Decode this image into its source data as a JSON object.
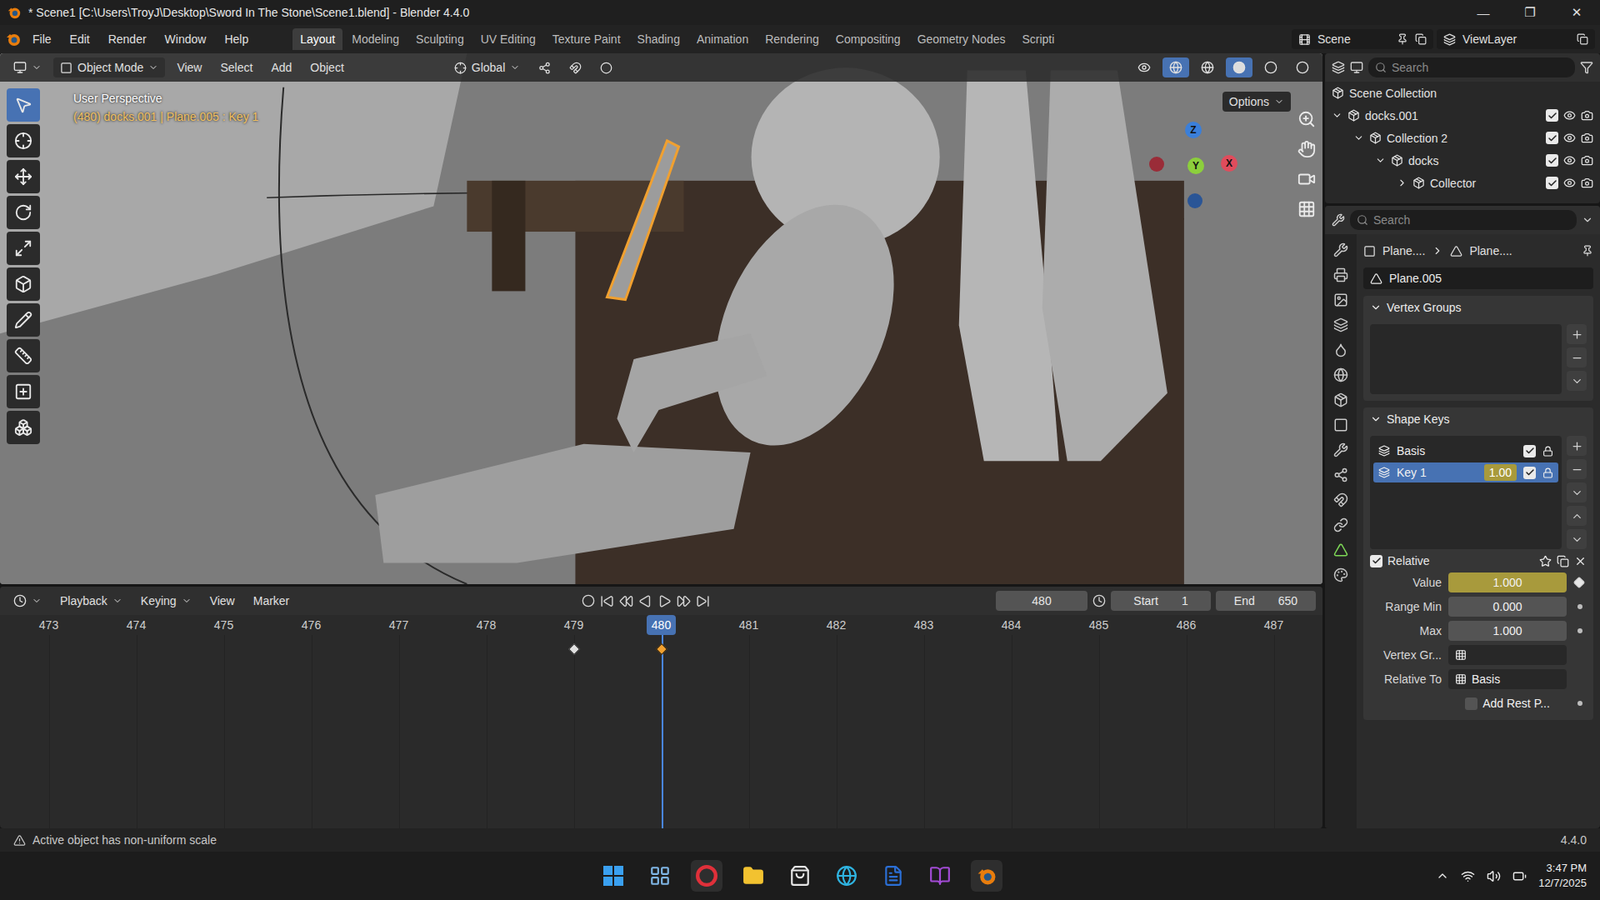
{
  "window": {
    "title": "* Scene1 [C:\\Users\\TroyJ\\Desktop\\Sword In The Stone\\Scene1.blend] - Blender 4.4.0",
    "controls": [
      "—",
      "❐",
      "✕"
    ]
  },
  "menu": [
    "File",
    "Edit",
    "Render",
    "Window",
    "Help"
  ],
  "workspaces": [
    {
      "label": "Layout",
      "selected": true
    },
    {
      "label": "Modeling",
      "selected": false
    },
    {
      "label": "Sculpting",
      "selected": false
    },
    {
      "label": "UV Editing",
      "selected": false
    },
    {
      "label": "Texture Paint",
      "selected": false
    },
    {
      "label": "Shading",
      "selected": false
    },
    {
      "label": "Animation",
      "selected": false
    },
    {
      "label": "Rendering",
      "selected": false
    },
    {
      "label": "Compositing",
      "selected": false
    },
    {
      "label": "Geometry Nodes",
      "selected": false
    },
    {
      "label": "Scripti",
      "selected": false
    }
  ],
  "scene": "Scene",
  "view_layer": "ViewLayer",
  "viewport": {
    "mode": "Object Mode",
    "menus": [
      "View",
      "Select",
      "Add",
      "Object"
    ],
    "orientation": "Global",
    "options": "Options",
    "view_name": "User Perspective",
    "info": "(480) docks.001 | Plane.005 : Key 1",
    "axes": [
      "X",
      "Y",
      "Z"
    ],
    "tools": [
      {
        "selected": true
      },
      {
        "selected": false
      },
      {
        "selected": false
      },
      {
        "selected": false
      },
      {
        "selected": false
      },
      {
        "selected": false
      },
      {
        "selected": false
      },
      {
        "selected": false
      },
      {
        "selected": false
      },
      {
        "selected": false
      }
    ]
  },
  "outliner": {
    "search": "Search",
    "root": "Scene Collection",
    "items": [
      {
        "name": "docks.001",
        "depth": 0,
        "expanded": true,
        "checked": true
      },
      {
        "name": "Collection 2",
        "depth": 1,
        "expanded": true,
        "checked": true
      },
      {
        "name": "docks",
        "depth": 2,
        "expanded": true,
        "checked": true
      },
      {
        "name": "Collector",
        "depth": 3,
        "expanded": false,
        "checked": true
      }
    ]
  },
  "properties": {
    "search": "Search",
    "breadcrumb": [
      "Plane....",
      "Plane...."
    ],
    "mesh": "Plane.005",
    "vertex_groups": {
      "title": "Vertex Groups",
      "expanded": true
    },
    "shape_keys": {
      "title": "Shape Keys",
      "expanded": true,
      "items": [
        {
          "name": "Basis",
          "value": "",
          "checked": true,
          "selected": false
        },
        {
          "name": "Key 1",
          "value": "1.00",
          "checked": true,
          "selected": true
        }
      ],
      "relative": {
        "label": "Relative",
        "checked": true
      },
      "fields": [
        {
          "label": "Value",
          "value": "1.000",
          "kind": "keyed"
        },
        {
          "label": "Range Min",
          "value": "0.000",
          "kind": "number"
        },
        {
          "label": "Max",
          "value": "1.000",
          "kind": "number"
        },
        {
          "label": "Vertex Gr...",
          "value": "",
          "kind": "picker"
        },
        {
          "label": "Relative To",
          "value": "Basis",
          "kind": "picker"
        },
        {
          "label": "Add Rest P...",
          "value": "",
          "kind": "checkbox",
          "checked": false
        }
      ]
    }
  },
  "timeline": {
    "menus": [
      "Playback",
      "Keying",
      "View",
      "Marker"
    ],
    "frame": "480",
    "start_label": "Start",
    "start": "1",
    "end_label": "End",
    "end": "650",
    "ruler": [
      "473",
      "474",
      "475",
      "476",
      "477",
      "478",
      "479",
      "480",
      "481",
      "482",
      "483",
      "484",
      "485",
      "486",
      "487"
    ],
    "current": "480",
    "keyframes": [
      {
        "frame": "479",
        "selected": false
      },
      {
        "frame": "480",
        "selected": true
      }
    ]
  },
  "status_bar": {
    "message": "Active object has non-uniform scale",
    "version": "4.4.0"
  },
  "taskbar": {
    "time": "3:47 PM",
    "date": "12/7/2025"
  }
}
